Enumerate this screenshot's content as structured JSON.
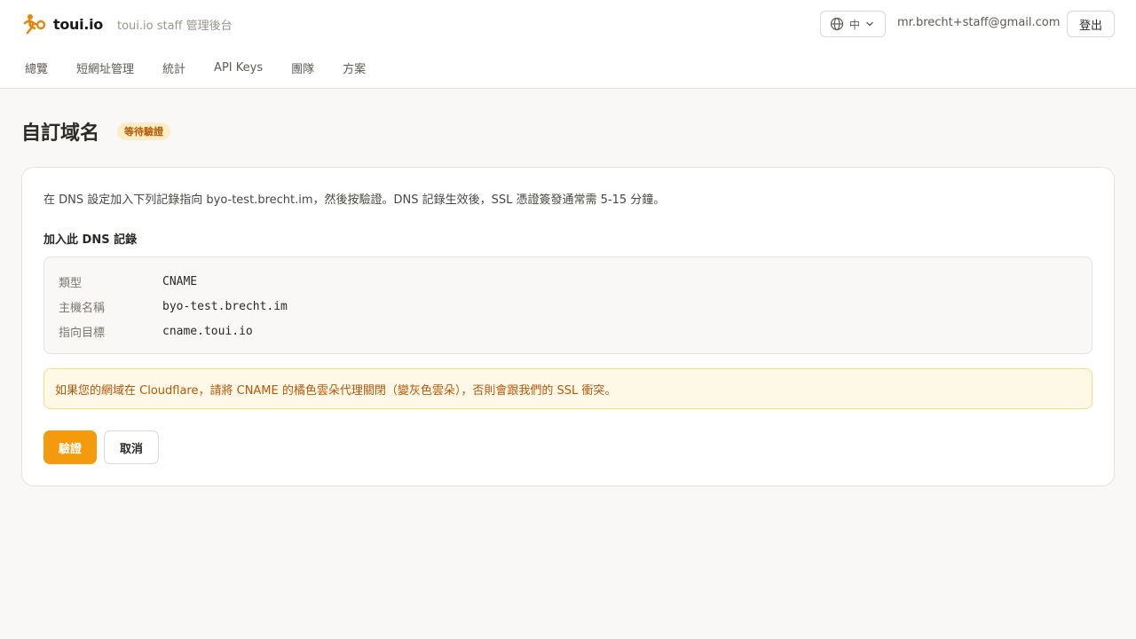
{
  "header": {
    "brand_name": "toui.io",
    "brand_subtitle": "toui.io staff 管理後台",
    "language_label": "中",
    "user_email": "mr.brecht+staff@gmail.com",
    "logout_label": "登出"
  },
  "nav": {
    "items": [
      {
        "label": "總覽"
      },
      {
        "label": "短網址管理"
      },
      {
        "label": "統計"
      },
      {
        "label": "API Keys"
      },
      {
        "label": "團隊"
      },
      {
        "label": "方案"
      }
    ]
  },
  "page": {
    "title": "自訂域名",
    "status_badge": "等待驗證"
  },
  "card": {
    "intro": "在 DNS 設定加入下列記錄指向 byo-test.brecht.im，然後按驗證。DNS 記錄生效後，SSL 憑證簽發通常需 5-15 分鐘。",
    "section_label": "加入此 DNS 記錄",
    "dns_records": [
      {
        "key": "類型",
        "value": "CNAME"
      },
      {
        "key": "主機名稱",
        "value": "byo-test.brecht.im"
      },
      {
        "key": "指向目標",
        "value": "cname.toui.io"
      }
    ],
    "warning": "如果您的網域在 Cloudflare，請將 CNAME 的橘色雲朵代理關閉（變灰色雲朵），否則會跟我們的 SSL 衝突。",
    "verify_label": "驗證",
    "cancel_label": "取消"
  },
  "colors": {
    "accent": "#f59a0c",
    "badge_bg": "#fdedc6",
    "badge_text": "#b25a06",
    "warning_bg": "#fef9e7",
    "warning_border": "#f7dc7d",
    "warning_text": "#b9560a"
  },
  "icons": {
    "logo": "running-person-logo-icon",
    "language": "globe-icon",
    "language_dropdown": "chevron-down-icon"
  }
}
